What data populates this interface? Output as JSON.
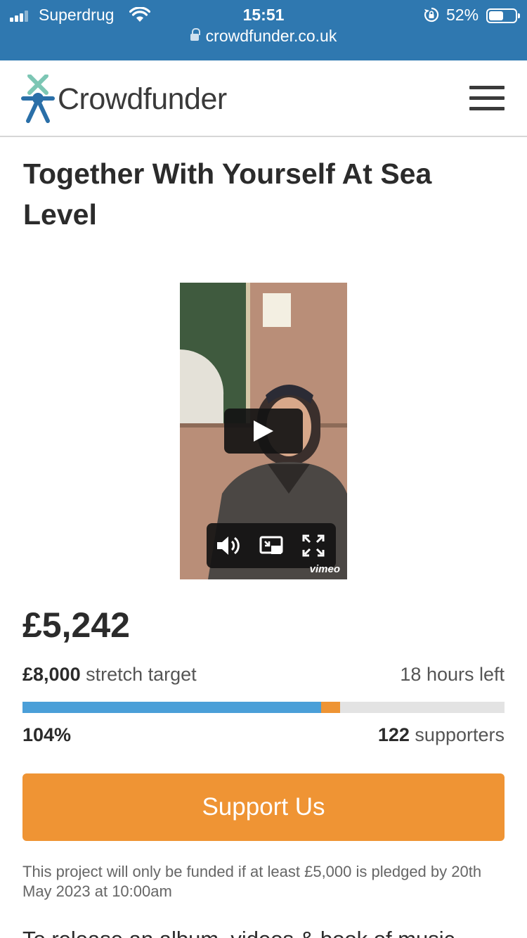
{
  "status_bar": {
    "carrier": "Superdrug",
    "time": "15:51",
    "battery_percent": "52%",
    "battery_level": 0.52,
    "url": "crowdfunder.co.uk"
  },
  "header": {
    "logo_text": "Crowdfunder",
    "menu_icon": "hamburger-menu-icon"
  },
  "project": {
    "title": "Together With Yourself At Sea Level",
    "video": {
      "play_icon": "play-icon",
      "volume_icon": "volume-icon",
      "pip_icon": "picture-in-picture-icon",
      "fullscreen_icon": "fullscreen-icon",
      "watermark": "vimeo"
    },
    "amount_raised": "£5,242",
    "target_amount": "£8,000",
    "target_label": "stretch target",
    "time_left": "18 hours left",
    "progress_funded_fraction": 0.62,
    "progress_stretch_fraction": 0.04,
    "percent_funded": "104%",
    "supporters_count": "122",
    "supporters_label": "supporters",
    "support_button_label": "Support Us",
    "funding_note": "This project will only be funded if at least £5,000 is pledged by 20th May 2023 at 10:00am",
    "description_start": "To release an album, videos & book of music"
  },
  "colors": {
    "status_bar": "#2f78b0",
    "accent_orange": "#ef9434",
    "progress_blue": "#4a9fd8"
  }
}
